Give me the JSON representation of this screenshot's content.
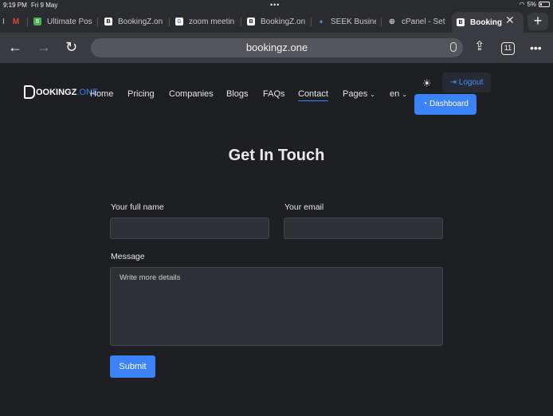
{
  "status": {
    "time": "9:19 PM",
    "date": "Fri 9 May",
    "battery": "5%"
  },
  "tabs": [
    {
      "label": "Ultimate Pos",
      "icon": "green-app-icon"
    },
    {
      "label": "BookingZ.on",
      "icon": "bookingzone-icon"
    },
    {
      "label": "zoom meetin",
      "icon": "google-icon"
    },
    {
      "label": "BookingZ.on",
      "icon": "bookingzone-icon"
    },
    {
      "label": "SEEK Busine",
      "icon": "seek-icon"
    },
    {
      "label": "cPanel - Set",
      "icon": "globe-icon"
    },
    {
      "label": "Booking",
      "icon": "bookingzone-icon"
    }
  ],
  "browser": {
    "url": "bookingz.one",
    "tab_count": "11"
  },
  "site": {
    "logo_main": "OOKINGZ",
    "logo_accent": ".ONE",
    "nav": [
      "Home",
      "Pricing",
      "Companies",
      "Blogs",
      "FAQs",
      "Contact",
      "Pages",
      "en"
    ],
    "logout": "Logout",
    "dashboard": "Dashboard"
  },
  "form": {
    "heading": "Get In Touch",
    "name_label": "Your full name",
    "email_label": "Your email",
    "message_label": "Message",
    "message_placeholder": "Write more details",
    "submit": "Submit"
  },
  "colors": {
    "accent": "#3b82f6",
    "background": "#1e1f22",
    "field": "#2e3136"
  }
}
